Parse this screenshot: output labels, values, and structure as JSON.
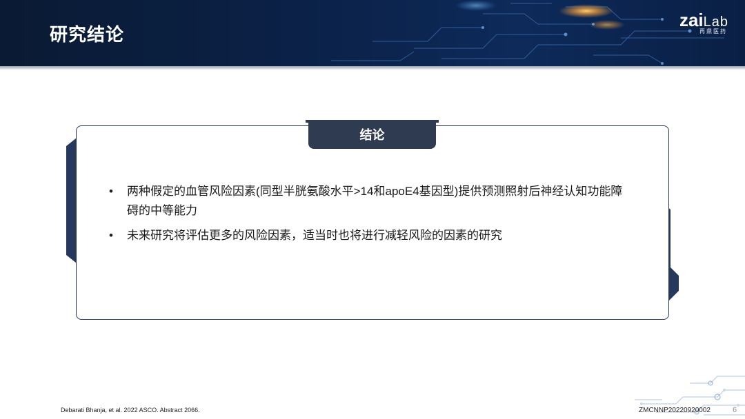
{
  "header": {
    "title": "研究结论",
    "logo_main": "zai",
    "logo_lab": "Lab",
    "logo_sub": "再鼎医药"
  },
  "panel": {
    "tab_label": "结论",
    "bullets": [
      {
        "marker": "•",
        "text": "两种假定的血管风险因素(同型半胱氨酸水平>14和apoE4基因型)提供预测照射后神经认知功能障碍的中等能力"
      },
      {
        "marker": "•",
        "text": "未来研究将评估更多的风险因素，适当时也将进行减轻风险的因素的研究"
      }
    ]
  },
  "footer": {
    "reference": "Debarati Bhanja, et al. 2022 ASCO. Abstract 2066.",
    "doc_code": "ZMCNNP20220920002",
    "page_number": "6"
  },
  "colors": {
    "header_dark": "#0b2147",
    "accent_navy": "#26395c",
    "tab_bg": "#2f3b50",
    "circuit_glow": "#f7a23a"
  },
  "icons": [
    "zai-lab-logo",
    "circuit-decoration"
  ]
}
